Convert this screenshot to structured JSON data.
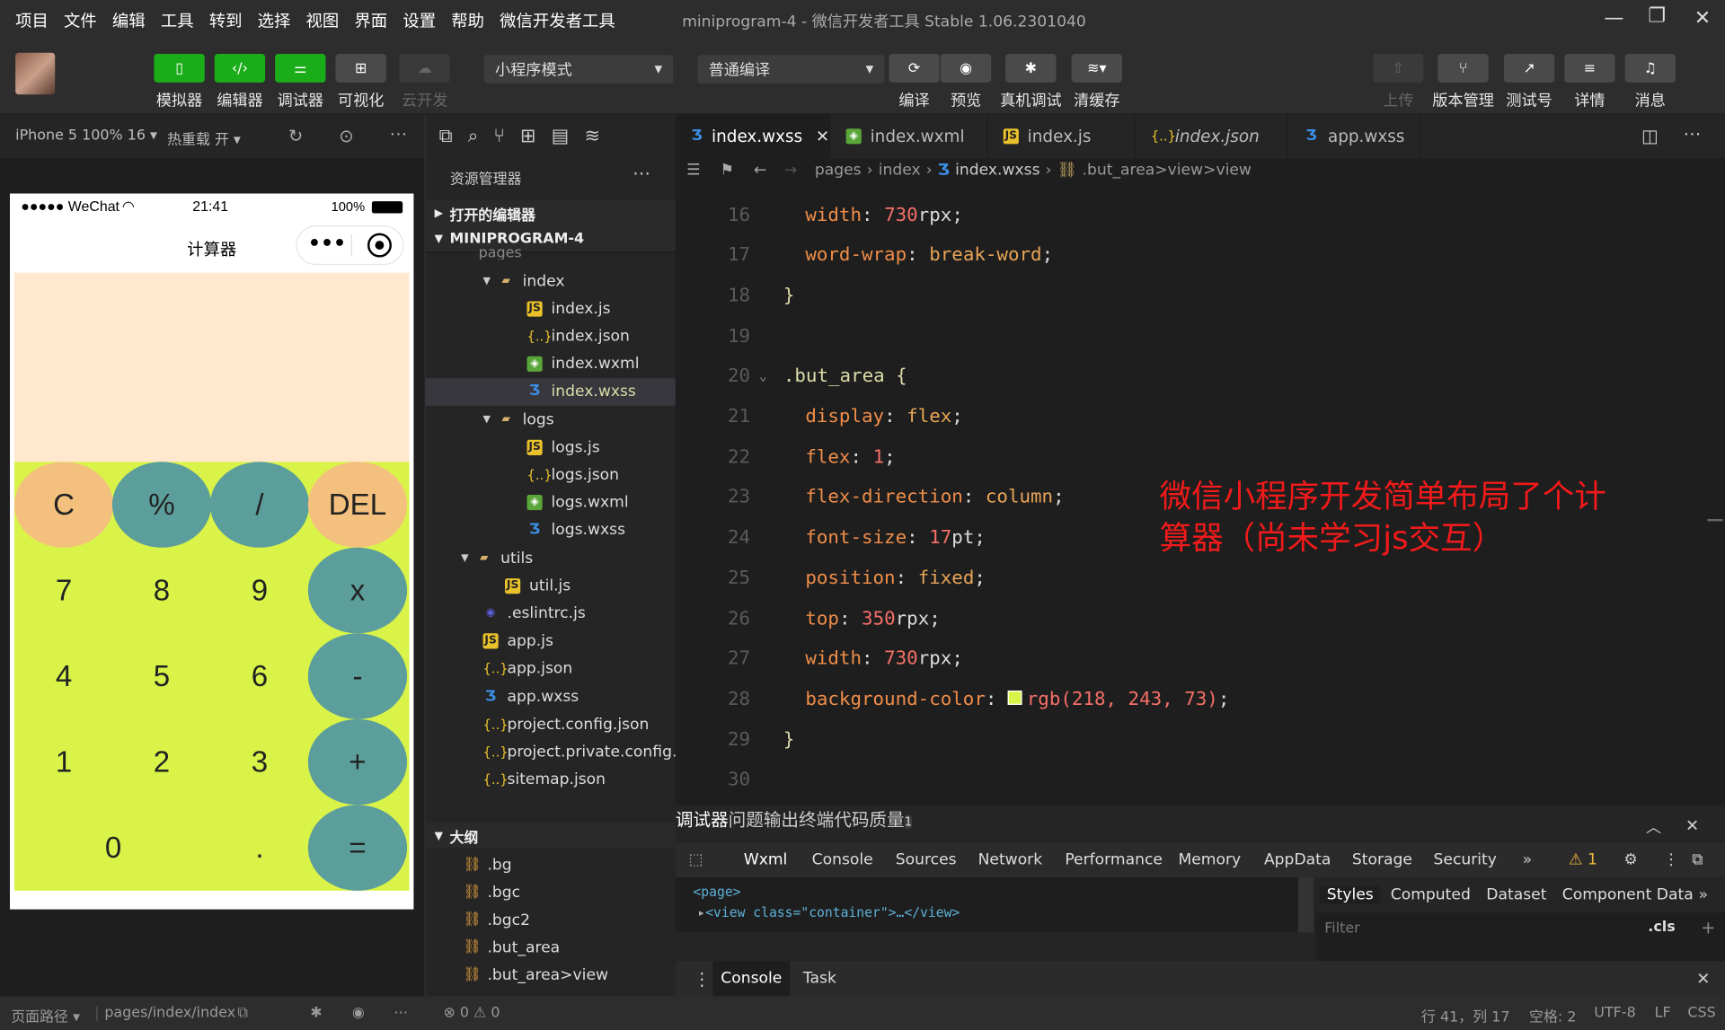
{
  "menu": [
    "项目",
    "文件",
    "编辑",
    "工具",
    "转到",
    "选择",
    "视图",
    "界面",
    "设置",
    "帮助",
    "微信开发者工具"
  ],
  "window_title": "miniprogram-4 - 微信开发者工具 Stable 1.06.2301040",
  "toolbar": {
    "simulator": "模拟器",
    "editor": "编辑器",
    "debugger": "调试器",
    "visual": "可视化",
    "cloud": "云开发",
    "mode": "小程序模式",
    "compile_mode": "普通编译",
    "compile": "编译",
    "preview": "预览",
    "real_debug": "真机调试",
    "clear_cache": "清缓存",
    "upload": "上传",
    "version": "版本管理",
    "test": "测试号",
    "details": "详情",
    "messages": "消息"
  },
  "subbar": {
    "device": "iPhone 5 100% 16 ▾",
    "hot_reload": "热重载 开 ▾"
  },
  "phone": {
    "carrier": "●●●●● WeChat",
    "time": "21:41",
    "battery": "100%",
    "title": "计算器",
    "keys": [
      {
        "label": "C",
        "color": "orange"
      },
      {
        "label": "%",
        "color": "teal"
      },
      {
        "label": "/",
        "color": "teal"
      },
      {
        "label": "DEL",
        "color": "orange"
      },
      {
        "label": "7"
      },
      {
        "label": "8"
      },
      {
        "label": "9"
      },
      {
        "label": "x",
        "color": "teal"
      },
      {
        "label": "4"
      },
      {
        "label": "5"
      },
      {
        "label": "6"
      },
      {
        "label": "-",
        "color": "teal"
      },
      {
        "label": "1"
      },
      {
        "label": "2"
      },
      {
        "label": "3"
      },
      {
        "label": "+",
        "color": "teal"
      },
      {
        "label": "0"
      },
      {
        "label": "."
      },
      {
        "label": "=",
        "color": "teal"
      }
    ]
  },
  "explorer": {
    "title": "资源管理器",
    "open_editors": "打开的编辑器",
    "project": "MINIPROGRAM-4",
    "pages_partial": "pages",
    "outline": "大纲",
    "files": [
      {
        "name": "index",
        "type": "folder",
        "indent": 1
      },
      {
        "name": "index.js",
        "type": "js",
        "indent": 2
      },
      {
        "name": "index.json",
        "type": "json",
        "indent": 2
      },
      {
        "name": "index.wxml",
        "type": "wxml",
        "indent": 2
      },
      {
        "name": "index.wxss",
        "type": "wxss",
        "indent": 2,
        "selected": true
      },
      {
        "name": "logs",
        "type": "folder",
        "indent": 1
      },
      {
        "name": "logs.js",
        "type": "js",
        "indent": 2
      },
      {
        "name": "logs.json",
        "type": "json",
        "indent": 2
      },
      {
        "name": "logs.wxml",
        "type": "wxml",
        "indent": 2
      },
      {
        "name": "logs.wxss",
        "type": "wxss",
        "indent": 2
      },
      {
        "name": "utils",
        "type": "folder",
        "indent": 0
      },
      {
        "name": "util.js",
        "type": "js",
        "indent": 1
      },
      {
        "name": ".eslintrc.js",
        "type": "eslint",
        "indent": 0
      },
      {
        "name": "app.js",
        "type": "js",
        "indent": 0
      },
      {
        "name": "app.json",
        "type": "json",
        "indent": 0
      },
      {
        "name": "app.wxss",
        "type": "wxss",
        "indent": 0
      },
      {
        "name": "project.config.json",
        "type": "json",
        "indent": 0
      },
      {
        "name": "project.private.config.js...",
        "type": "json",
        "indent": 0
      },
      {
        "name": "sitemap.json",
        "type": "json",
        "indent": 0
      }
    ],
    "outline_items": [
      ".bg",
      ".bgc",
      ".bgc2",
      ".but_area",
      ".but_area>view"
    ]
  },
  "tabs": [
    {
      "name": "index.wxss",
      "type": "wxss",
      "active": true
    },
    {
      "name": "index.wxml",
      "type": "wxml"
    },
    {
      "name": "index.js",
      "type": "js"
    },
    {
      "name": "index.json",
      "type": "json"
    },
    {
      "name": "app.wxss",
      "type": "wxss"
    }
  ],
  "breadcrumb": {
    "a": "pages",
    "b": "index",
    "c": "index.wxss",
    "d": ".but_area>view>view"
  },
  "code_lines": [
    {
      "n": "16",
      "prop": "width",
      "val": "730",
      "unit": "rpx"
    },
    {
      "n": "17",
      "prop": "word-wrap",
      "val": "break-word"
    },
    {
      "n": "18",
      "brace": "}"
    },
    {
      "n": "19"
    },
    {
      "n": "20",
      "sel": ".but_area {"
    },
    {
      "n": "21",
      "prop": "display",
      "val": "flex"
    },
    {
      "n": "22",
      "prop": "flex",
      "val": "1"
    },
    {
      "n": "23",
      "prop": "flex-direction",
      "val": "column"
    },
    {
      "n": "24",
      "prop": "font-size",
      "val": "17",
      "unit": "pt"
    },
    {
      "n": "25",
      "prop": "position",
      "val": "fixed"
    },
    {
      "n": "26",
      "prop": "top",
      "val": "350",
      "unit": "rpx"
    },
    {
      "n": "27",
      "prop": "width",
      "val": "730",
      "unit": "rpx"
    },
    {
      "n": "28",
      "prop": "background-color",
      "val": "rgb(218, 243, 73)",
      "swatch": "#daf349"
    },
    {
      "n": "29",
      "brace": "}"
    },
    {
      "n": "30"
    }
  ],
  "annotation": "微信小程序开发简单布局了个计算器（尚未学习js交互）",
  "debugger": {
    "tabs": [
      "调试器",
      "问题",
      "输出",
      "终端",
      "代码质量"
    ],
    "badge": "1",
    "devtabs": [
      "Wxml",
      "Console",
      "Sources",
      "Network",
      "Performance",
      "Memory",
      "AppData",
      "Storage",
      "Security"
    ],
    "warn": "⚠ 1",
    "page_tag": "<page>",
    "view_line": "<view class=\"container\">…</view>",
    "styles_tabs": [
      "Styles",
      "Computed",
      "Dataset",
      "Component Data"
    ],
    "filter": "Filter",
    "cls": ".cls",
    "drawer": [
      "Console",
      "Task"
    ]
  },
  "status": {
    "path_label": "页面路径 ▾",
    "path": "pages/index/index",
    "errors": "⊗ 0 ⚠ 0",
    "pos": "行 41，列 17",
    "spaces": "空格: 2",
    "encoding": "UTF-8",
    "eol": "LF",
    "lang": "CSS"
  }
}
